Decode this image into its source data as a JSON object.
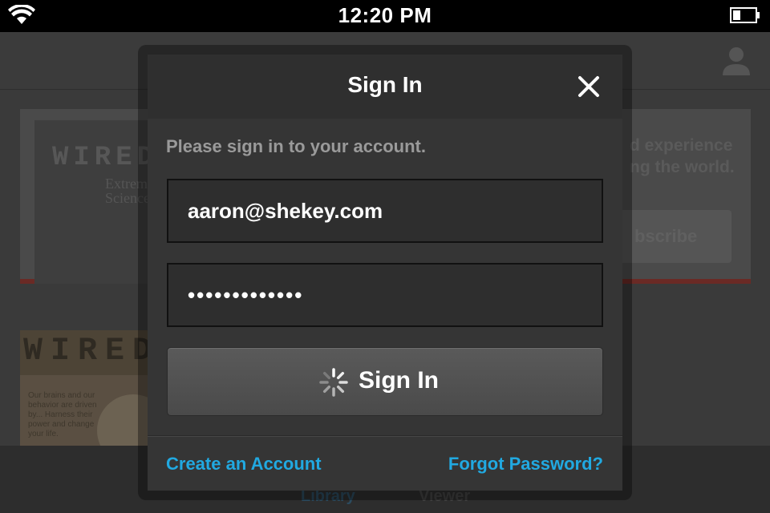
{
  "status_bar": {
    "time": "12:20 PM",
    "icons": [
      "wifi-icon",
      "battery-icon"
    ]
  },
  "background_app": {
    "header_title": "",
    "promo": {
      "cover_letters": "WIRED",
      "cover_subtitle": "Extreme Science",
      "text": "d experience ng the world.",
      "button_label": "bscribe"
    },
    "library_cover": {
      "letters": "WIRED",
      "blurb": "Our brains and our behavior are driven by... Harness their power and change your life."
    },
    "tabs": {
      "library": "Library",
      "viewer": "Viewer"
    },
    "colors": {
      "promo_accent": "#6a2a25",
      "library_tab": "#2c4b5f"
    }
  },
  "modal": {
    "title": "Sign In",
    "prompt": "Please sign in to your account.",
    "email_value": "aaron@shekey.com",
    "password_value": "•••••••••••••",
    "signin_label": "Sign In",
    "signin_loading": true,
    "create_account_label": "Create an Account",
    "forgot_password_label": "Forgot Password?",
    "colors": {
      "link": "#21a9e1",
      "background": "#353535",
      "header": "#2f2f2f"
    }
  }
}
